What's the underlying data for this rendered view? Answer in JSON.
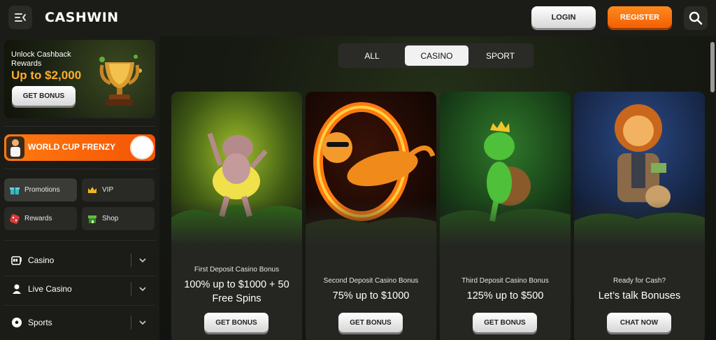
{
  "header": {
    "logo": "CASHWIN",
    "login_label": "LOGIN",
    "register_label": "REGISTER",
    "menu_icon": "menu-collapse-icon",
    "search_icon": "search-icon"
  },
  "sidebar": {
    "promo": {
      "line1": "Unlock Cashback Rewards",
      "amount": "Up to $2,000",
      "button": "GET BONUS"
    },
    "worldcup_label": "WORLD CUP FRENZY",
    "tiles": [
      {
        "label": "Promotions",
        "icon": "gift-icon"
      },
      {
        "label": "VIP",
        "icon": "crown-icon"
      },
      {
        "label": "Rewards",
        "icon": "dice-icon"
      },
      {
        "label": "Shop",
        "icon": "shop-icon"
      }
    ],
    "nav": [
      {
        "label": "Casino",
        "icon": "slot-machine-icon"
      },
      {
        "label": "Live Casino",
        "icon": "dealer-icon"
      },
      {
        "label": "Sports",
        "icon": "soccer-ball-icon"
      }
    ]
  },
  "tabs": {
    "items": [
      "ALL",
      "CASINO",
      "SPORT"
    ],
    "active": "CASINO"
  },
  "cards": [
    {
      "subtitle": "First Deposit Casino Bonus",
      "headline_1": "100% up to $1000 + 50",
      "headline_2": "Free Spins",
      "button": "GET BONUS"
    },
    {
      "subtitle": "Second Deposit Casino Bonus",
      "headline_1": "75% up to $1000",
      "headline_2": "",
      "button": "GET BONUS"
    },
    {
      "subtitle": "Third Deposit Casino Bonus",
      "headline_1": "125% up to $500",
      "headline_2": "",
      "button": "GET BONUS"
    },
    {
      "subtitle": "Ready for Cash?",
      "headline_1": "Let’s talk Bonuses",
      "headline_2": "",
      "button": "CHAT NOW"
    }
  ],
  "colors": {
    "accent_orange": "#f35f05",
    "promo_amount": "#ffae2e",
    "background": "#141511"
  }
}
